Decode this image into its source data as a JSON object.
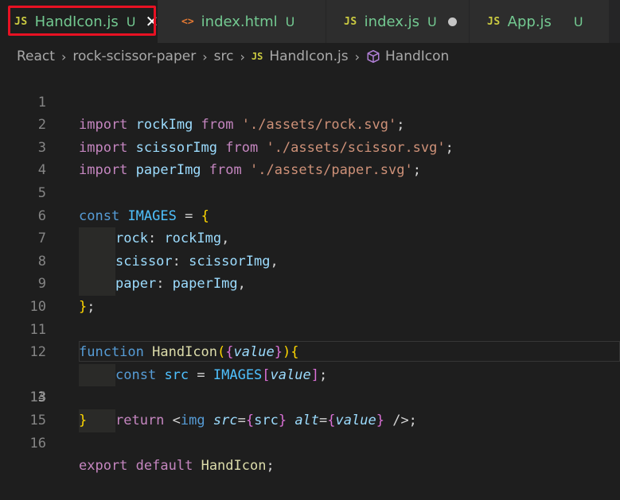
{
  "tabs": [
    {
      "icon": "JS",
      "name": "HandIcon.js",
      "status": "U",
      "active": true
    },
    {
      "icon": "<>",
      "name": "index.html",
      "status": "U"
    },
    {
      "icon": "JS",
      "name": "index.js",
      "status": "U",
      "modified": true
    },
    {
      "icon": "JS",
      "name": "App.js",
      "status": "U"
    }
  ],
  "breadcrumb": {
    "items": [
      "React",
      "rock-scissor-paper",
      "src"
    ],
    "file_icon": "JS",
    "file": "HandIcon.js",
    "symbol": "HandIcon"
  },
  "editor": {
    "active_line": 13,
    "lines": [
      {
        "n": "1",
        "t": [
          "import",
          " rockImg ",
          "from",
          " ",
          "'./assets/rock.svg'",
          ";"
        ]
      },
      {
        "n": "2",
        "t": [
          "import",
          " scissorImg ",
          "from",
          " ",
          "'./assets/scissor.svg'",
          ";"
        ]
      },
      {
        "n": "3",
        "t": [
          "import",
          " paperImg ",
          "from",
          " ",
          "'./assets/paper.svg'",
          ";"
        ]
      },
      {
        "n": "4",
        "t": []
      },
      {
        "n": "5",
        "t": [
          "const",
          " ",
          "IMAGES",
          " = ",
          "{"
        ]
      },
      {
        "n": "6",
        "t": [
          "rock",
          ": ",
          "rockImg",
          ","
        ]
      },
      {
        "n": "7",
        "t": [
          "scissor",
          ": ",
          "scissorImg",
          ","
        ]
      },
      {
        "n": "8",
        "t": [
          "paper",
          ": ",
          "paperImg",
          ","
        ]
      },
      {
        "n": "9",
        "t": [
          "}",
          ";"
        ]
      },
      {
        "n": "10",
        "t": []
      },
      {
        "n": "11",
        "t": [
          "function",
          " ",
          "HandIcon",
          "(",
          "{",
          "value",
          "}",
          ")",
          "{"
        ]
      },
      {
        "n": "12",
        "t": [
          "const",
          " ",
          "src",
          " = ",
          "IMAGES",
          "[",
          "value",
          "]",
          ";"
        ]
      },
      {
        "n": "13",
        "t": [
          "return",
          " <",
          "img",
          " ",
          "src",
          "=",
          "{",
          "src",
          "}",
          " ",
          "alt",
          "=",
          "{",
          "value",
          "}",
          " />;"
        ]
      },
      {
        "n": "14",
        "t": [
          "}"
        ]
      },
      {
        "n": "15",
        "t": []
      },
      {
        "n": "16",
        "t": [
          "export",
          " ",
          "default",
          " ",
          "HandIcon",
          ";"
        ]
      }
    ]
  },
  "colors": {
    "highlight_border": "#e81123",
    "untracked_green": "#73c991",
    "js_icon_yellow": "#cbcb41",
    "keyword_blue": "#569cd6",
    "string_orange": "#ce9178"
  }
}
